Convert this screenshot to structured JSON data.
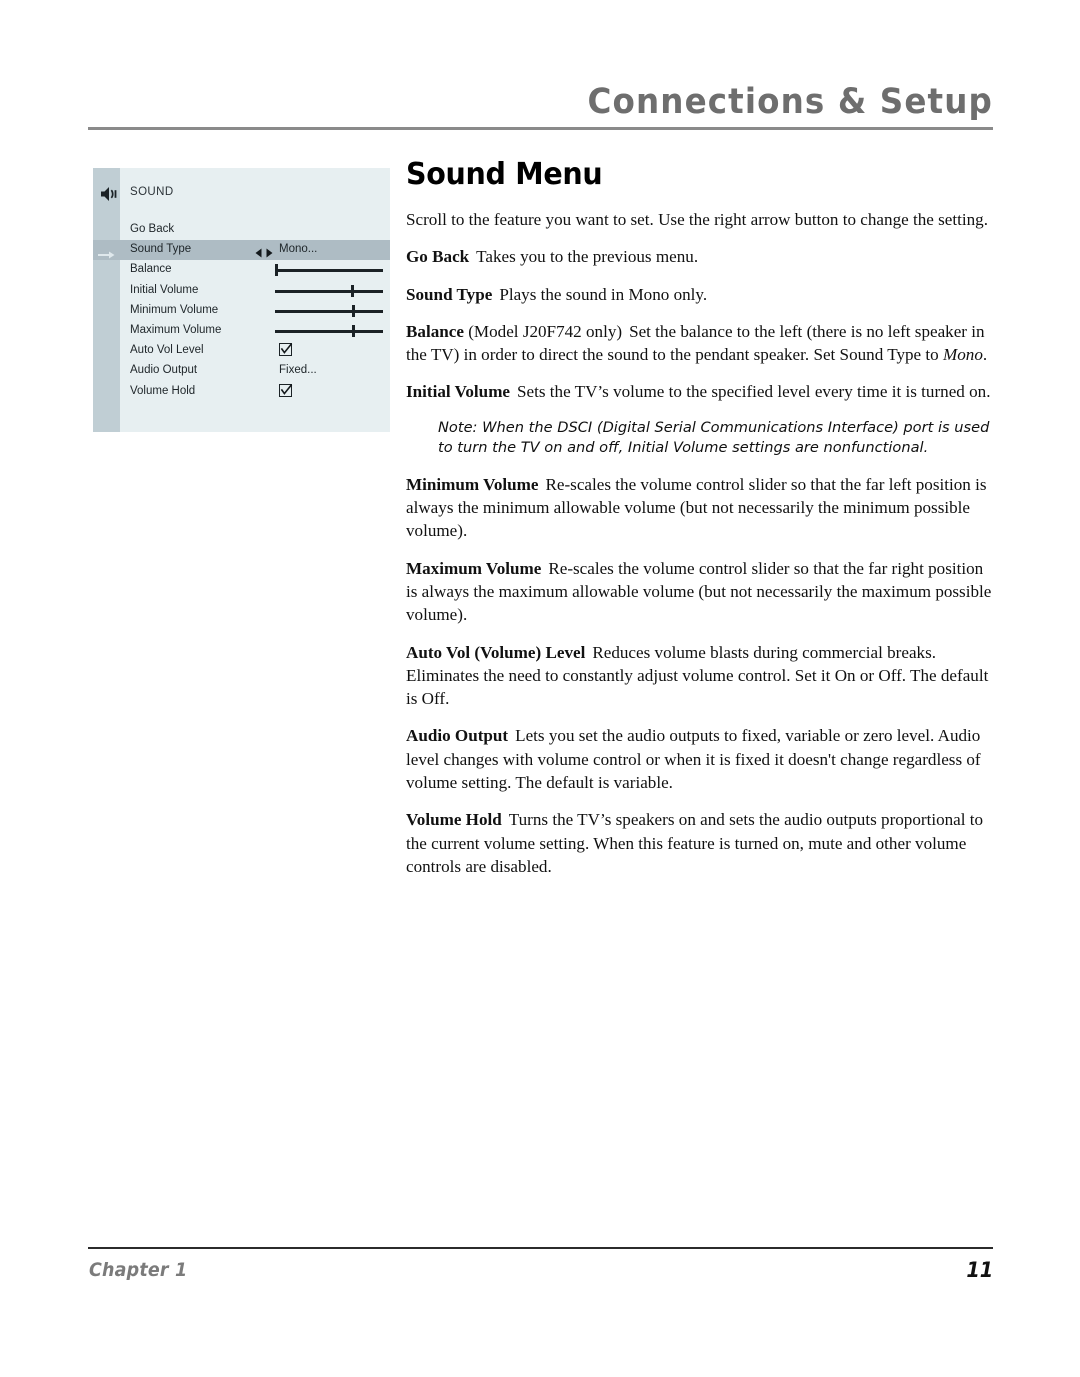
{
  "header": {
    "title": "Connections & Setup"
  },
  "osd": {
    "icon": "speaker-sound-icon",
    "title": "SOUND",
    "selected_index": 1,
    "rows": [
      {
        "label": "Go Back",
        "control": "none"
      },
      {
        "label": "Sound Type",
        "control": "spinner",
        "value": "Mono...",
        "arrows": "left-right-arrows"
      },
      {
        "label": "Balance",
        "control": "slider",
        "position_pct": 0
      },
      {
        "label": "Initial Volume",
        "control": "slider",
        "position_pct": 72
      },
      {
        "label": "Minimum Volume",
        "control": "slider",
        "position_pct": 73
      },
      {
        "label": "Maximum Volume",
        "control": "slider",
        "position_pct": 73
      },
      {
        "label": "Auto Vol Level",
        "control": "checkbox",
        "checked": true
      },
      {
        "label": "Audio Output",
        "control": "text",
        "value": "Fixed..."
      },
      {
        "label": "Volume Hold",
        "control": "checkbox",
        "checked": true
      }
    ]
  },
  "main": {
    "title": "Sound Menu",
    "intro": "Scroll to the feature you want to set. Use the right arrow button to change the setting.",
    "entries": [
      {
        "term": "Go Back",
        "text": "Takes you to the previous menu."
      },
      {
        "term": "Sound Type",
        "text": "Plays the sound in Mono only."
      },
      {
        "term": "Balance",
        "term_suffix": "(Model J20F742 only)",
        "text": "Set the balance to the left (there is no left speaker in the TV) in order to direct the sound to the pendant speaker. Set Sound Type to ",
        "text_italic_tail": "Mono",
        "text_tail": "."
      },
      {
        "term": "Initial Volume",
        "text": "Sets the TV’s volume to the specified level every time it is turned on."
      },
      {
        "term": "Minimum Volume",
        "text": "Re-scales the volume control slider so that the far left position is always the minimum allowable volume (but not necessarily the minimum possible volume)."
      },
      {
        "term": "Maximum Volume",
        "text": "Re-scales the volume control slider so that the far right position is always the maximum allowable volume (but not necessarily the maximum possible volume)."
      },
      {
        "term": "Auto Vol (Volume) Level",
        "text": "Reduces volume blasts during commercial breaks. Eliminates the need to constantly adjust volume control. Set it On or Off. The default is Off."
      },
      {
        "term": "Audio Output",
        "text": "Lets you set the audio outputs to fixed, variable or zero level. Audio level changes with volume control or when it is fixed it doesn't change regardless of volume setting. The default is variable."
      },
      {
        "term": "Volume Hold",
        "text": "Turns the TV’s speakers on and sets the audio outputs proportional to the current volume setting. When this feature is turned on, mute and other volume controls are disabled."
      }
    ],
    "note": "Note: When the DSCI (Digital Serial Communications Interface) port is used to turn the TV on and off, Initial Volume settings are nonfunctional."
  },
  "footer": {
    "chapter": "Chapter 1",
    "page_number": "11"
  },
  "colors": {
    "header_gray": "#6e6e6e",
    "osd_panel": "#e7eff1",
    "osd_gutter": "#c0ced4",
    "osd_selected": "#aebcc4",
    "osd_ink": "#1e2529",
    "footer_chapter": "#7b7b7b"
  }
}
